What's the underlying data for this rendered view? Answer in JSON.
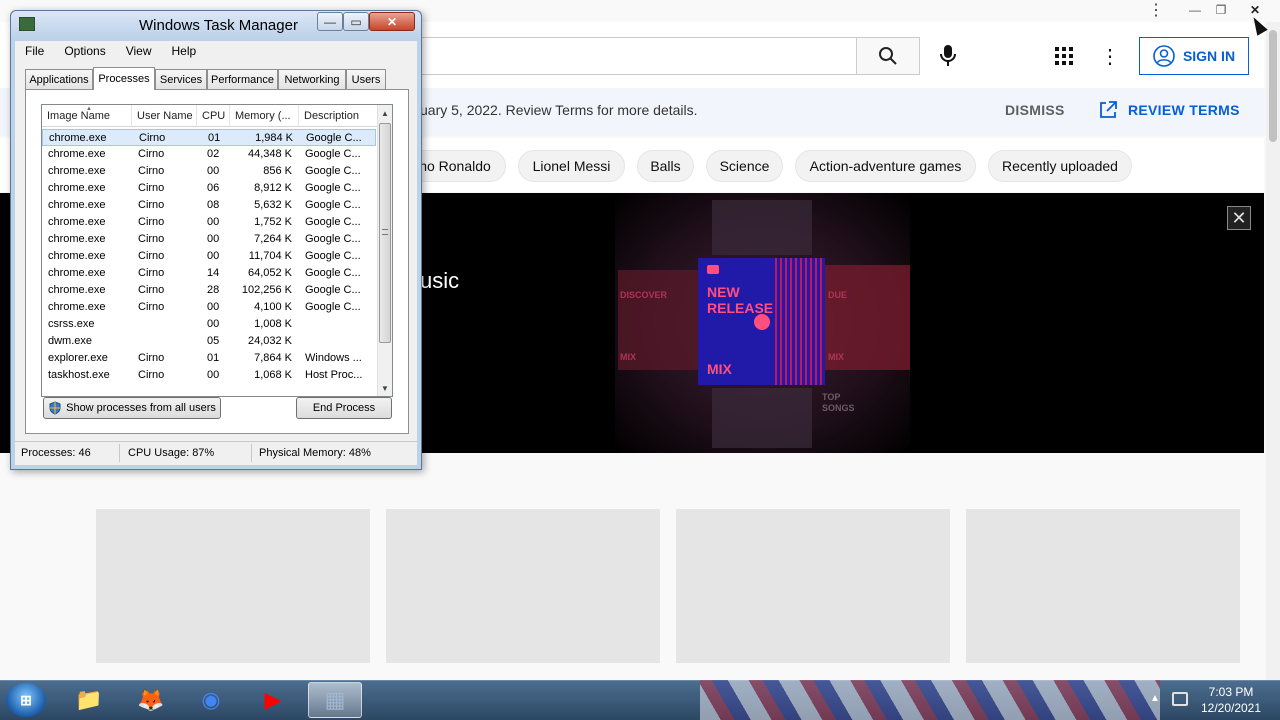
{
  "browser": {
    "title_fragment": "",
    "window_controls": {
      "minimize": "—",
      "restore": "❐",
      "close": "✕"
    }
  },
  "youtube": {
    "search_placeholder": "",
    "sign_in_label": "SIGN IN",
    "banner": {
      "text": "uary 5, 2022. Review Terms for more details.",
      "dismiss_label": "DISMISS",
      "review_label": "REVIEW TERMS"
    },
    "chips": [
      "no Ronaldo",
      "Lionel Messi",
      "Balls",
      "Science",
      "Action-adventure games",
      "Recently uploaded"
    ],
    "hero": {
      "title_fragment": "usic",
      "card_headline": "NEW RELEASE",
      "card_footer": "MIX",
      "side_labels": [
        "DISCOVER",
        "MIX",
        "TOP SONGS",
        "MIX",
        "DUE"
      ],
      "close_label": "✕"
    },
    "thumbnails_count": 4
  },
  "task_manager": {
    "title": "Windows Task Manager",
    "title_buttons": {
      "minimize": "—",
      "maximize": "▭",
      "close": "✕"
    },
    "menu": [
      "File",
      "Options",
      "View",
      "Help"
    ],
    "tabs": [
      {
        "label": "Applications",
        "active": false
      },
      {
        "label": "Processes",
        "active": true
      },
      {
        "label": "Services",
        "active": false
      },
      {
        "label": "Performance",
        "active": false
      },
      {
        "label": "Networking",
        "active": false
      },
      {
        "label": "Users",
        "active": false
      }
    ],
    "columns": [
      "Image Name",
      "User Name",
      "CPU",
      "Memory (...",
      "Description"
    ],
    "processes": [
      {
        "image": "chrome.exe",
        "user": "Cirno",
        "cpu": "01",
        "memory": "1,984 K",
        "description": "Google C...",
        "selected": true
      },
      {
        "image": "chrome.exe",
        "user": "Cirno",
        "cpu": "02",
        "memory": "44,348 K",
        "description": "Google C..."
      },
      {
        "image": "chrome.exe",
        "user": "Cirno",
        "cpu": "00",
        "memory": "856 K",
        "description": "Google C..."
      },
      {
        "image": "chrome.exe",
        "user": "Cirno",
        "cpu": "06",
        "memory": "8,912 K",
        "description": "Google C..."
      },
      {
        "image": "chrome.exe",
        "user": "Cirno",
        "cpu": "08",
        "memory": "5,632 K",
        "description": "Google C..."
      },
      {
        "image": "chrome.exe",
        "user": "Cirno",
        "cpu": "00",
        "memory": "1,752 K",
        "description": "Google C..."
      },
      {
        "image": "chrome.exe",
        "user": "Cirno",
        "cpu": "00",
        "memory": "7,264 K",
        "description": "Google C..."
      },
      {
        "image": "chrome.exe",
        "user": "Cirno",
        "cpu": "00",
        "memory": "11,704 K",
        "description": "Google C..."
      },
      {
        "image": "chrome.exe",
        "user": "Cirno",
        "cpu": "14",
        "memory": "64,052 K",
        "description": "Google C..."
      },
      {
        "image": "chrome.exe",
        "user": "Cirno",
        "cpu": "28",
        "memory": "102,256 K",
        "description": "Google C..."
      },
      {
        "image": "chrome.exe",
        "user": "Cirno",
        "cpu": "00",
        "memory": "4,100 K",
        "description": "Google C..."
      },
      {
        "image": "csrss.exe",
        "user": "",
        "cpu": "00",
        "memory": "1,008 K",
        "description": ""
      },
      {
        "image": "dwm.exe",
        "user": "",
        "cpu": "05",
        "memory": "24,032 K",
        "description": ""
      },
      {
        "image": "explorer.exe",
        "user": "Cirno",
        "cpu": "01",
        "memory": "7,864 K",
        "description": "Windows ..."
      },
      {
        "image": "taskhost.exe",
        "user": "Cirno",
        "cpu": "00",
        "memory": "1,068 K",
        "description": "Host Proc..."
      }
    ],
    "show_all_label": "Show processes from all users",
    "end_process_label": "End Process",
    "status": {
      "processes": "Processes: 46",
      "cpu": "CPU Usage: 87%",
      "memory": "Physical Memory: 48%"
    }
  },
  "taskbar": {
    "start_label": "⊞",
    "apps": [
      {
        "name": "explorer",
        "icon": "folder-icon",
        "glyph": "📁",
        "active": false
      },
      {
        "name": "firefox",
        "icon": "firefox-icon",
        "glyph": "🦊",
        "active": false
      },
      {
        "name": "chrome",
        "icon": "chrome-icon",
        "glyph": "◉",
        "active": false
      },
      {
        "name": "youtube",
        "icon": "youtube-icon",
        "glyph": "▶",
        "active": false
      },
      {
        "name": "task-manager",
        "icon": "task-manager-icon",
        "glyph": "▦",
        "active": true
      }
    ],
    "tray_arrow": "▲",
    "time": "7:03 PM",
    "date": "12/20/2021"
  },
  "colors": {
    "youtube_blue": "#065fd4",
    "new_release_card": "#2119a8",
    "new_release_text": "#ff4e7f",
    "task_manager_frame": "#bcd1ea",
    "taskbar": "#2b4763"
  }
}
